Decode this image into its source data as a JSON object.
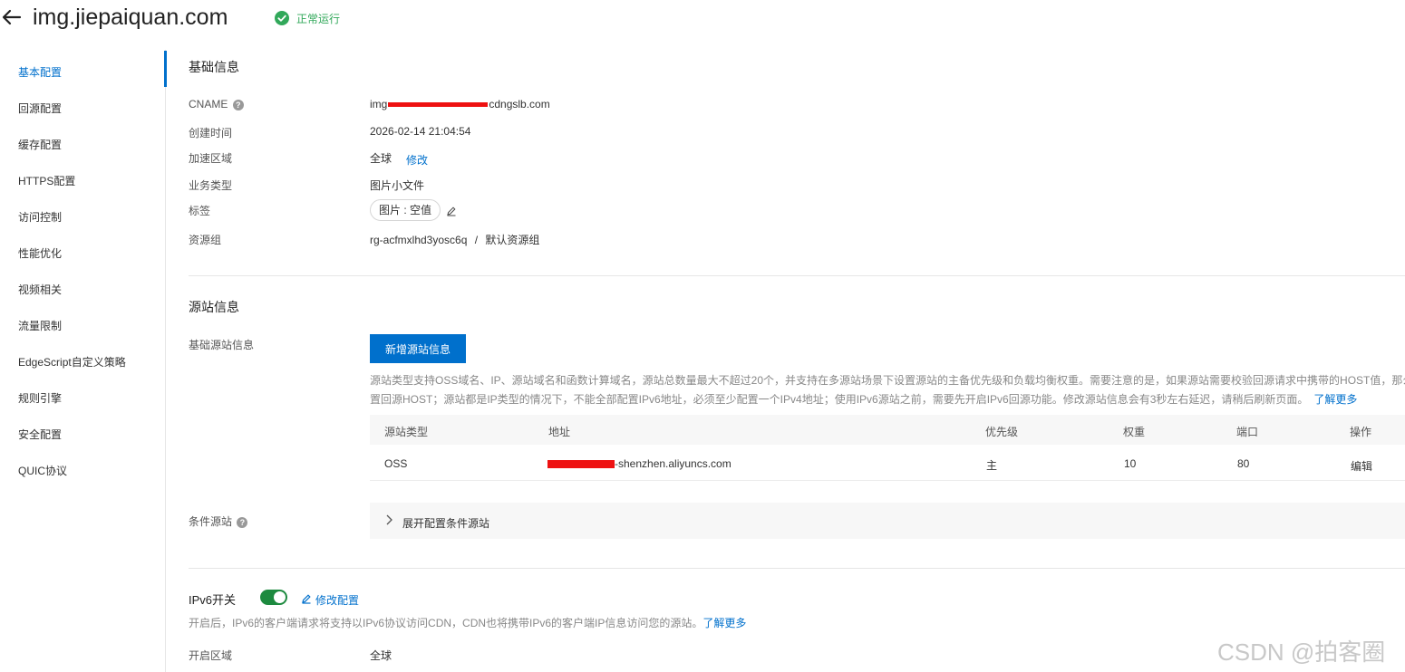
{
  "header": {
    "title": "img.jiepaiquan.com",
    "status": "正常运行",
    "status_color": "#31a85a"
  },
  "sidebar": {
    "items": [
      {
        "label": "基本配置",
        "active": true
      },
      {
        "label": "回源配置"
      },
      {
        "label": "缓存配置"
      },
      {
        "label": "HTTPS配置"
      },
      {
        "label": "访问控制"
      },
      {
        "label": "性能优化"
      },
      {
        "label": "视频相关"
      },
      {
        "label": "流量限制"
      },
      {
        "label": "EdgeScript自定义策略"
      },
      {
        "label": "规则引擎"
      },
      {
        "label": "安全配置"
      },
      {
        "label": "QUIC协议"
      }
    ]
  },
  "basic_info": {
    "title": "基础信息",
    "cname_label": "CNAME",
    "cname_prefix": "img",
    "cname_suffix": "cdngslb.com",
    "created_label": "创建时间",
    "created_value": "2026-02-14 21:04:54",
    "region_label": "加速区域",
    "region_value": "全球",
    "region_modify": "修改",
    "business_label": "业务类型",
    "business_value": "图片小文件",
    "tag_label": "标签",
    "tag_value": "图片 : 空值",
    "resource_label": "资源组",
    "resource_id": "rg-acfmxlhd3yosc6q",
    "resource_sep": "/",
    "resource_name": "默认资源组"
  },
  "origin_info": {
    "title": "源站信息",
    "basic_label": "基础源站信息",
    "add_button": "新增源站信息",
    "desc_line1": "源站类型支持OSS域名、IP、源站域名和函数计算域名，源站总数量最大不超过20个，并支持在多源站场景下设置源站的主备优先级和负载均衡权重。需要注意的是，如果源站需要校验回源请求中携带的HOST值，那么",
    "desc_line2": "置回源HOST；源站都是IP类型的情况下，不能全部配置IPv6地址，必须至少配置一个IPv4地址；使用IPv6源站之前，需要先开启IPv6回源功能。修改源站信息会有3秒左右延迟，请稍后刷新页面。",
    "learn_more": "了解更多",
    "table": {
      "headers": [
        "源站类型",
        "地址",
        "优先级",
        "权重",
        "端口",
        "操作"
      ],
      "rows": [
        {
          "type": "OSS",
          "address_suffix": "-shenzhen.aliyuncs.com",
          "priority": "主",
          "weight": "10",
          "port": "80",
          "action": "编辑"
        }
      ]
    },
    "conditional_label": "条件源站",
    "conditional_expand": "展开配置条件源站"
  },
  "ipv6": {
    "title": "IPv6开关",
    "enabled": true,
    "modify": "修改配置",
    "desc": "开启后，IPv6的客户端请求将支持以IPv6协议访问CDN，CDN也将携带IPv6的客户端IP信息访问您的源站。",
    "learn_more": "了解更多",
    "region_label": "开启区域",
    "region_value": "全球"
  },
  "watermark": "CSDN @拍客圈",
  "colors": {
    "accent": "#0070cc",
    "toggle_on": "#1d8a3f",
    "redaction": "#ee1111"
  }
}
